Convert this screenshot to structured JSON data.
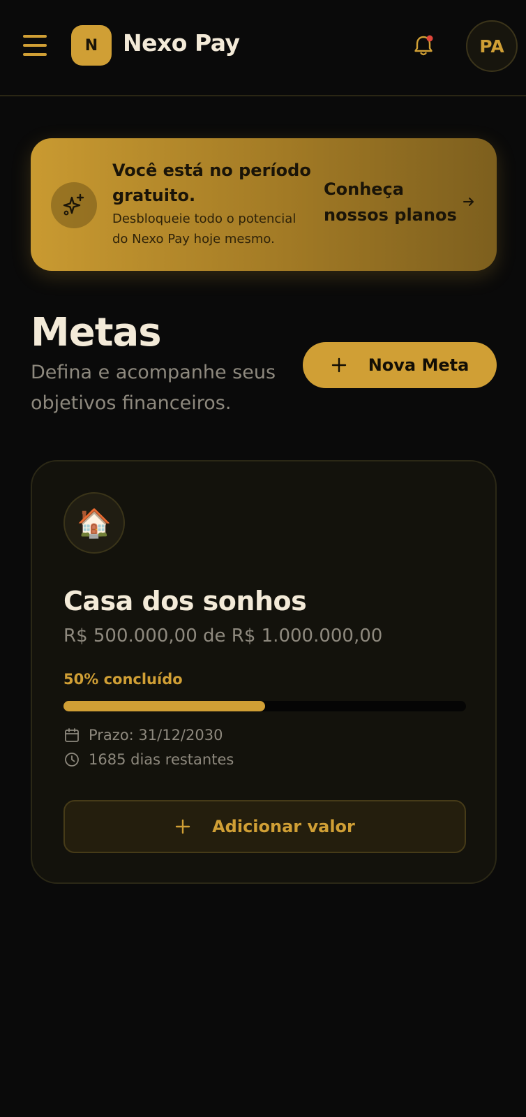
{
  "header": {
    "logo_letter": "N",
    "app_name": "Nexo Pay",
    "avatar_initials": "PA",
    "icons": [
      "menu-icon",
      "bell-icon"
    ],
    "notification_dot_color": "#e0463b"
  },
  "promo": {
    "title": "Você está no período gratuito.",
    "subtitle": "Desbloqueie todo o potencial do Nexo Pay hoje mesmo.",
    "cta": "Conheça nossos planos",
    "icons": [
      "sparkles-icon",
      "arrow-right-icon"
    ]
  },
  "page": {
    "title": "Metas",
    "subtitle": "Defina e acompanhe seus objetivos financeiros.",
    "new_goal_label": "Nova Meta"
  },
  "goals": [
    {
      "emoji": "🏠",
      "name": "Casa dos sonhos",
      "amount_text": "R$ 500.000,00 de R$ 1.000.000,00",
      "progress_label": "50% concluído",
      "progress_fraction": 0.5,
      "deadline": "Prazo: 31/12/2030",
      "days_left": "1685 dias restantes",
      "add_value_label": "Adicionar valor"
    }
  ],
  "colors": {
    "background": "#0a0a0a",
    "accent": "#d09f35",
    "card": "#13120c",
    "text_primary": "#f3ead8",
    "text_muted": "#8e897e"
  }
}
